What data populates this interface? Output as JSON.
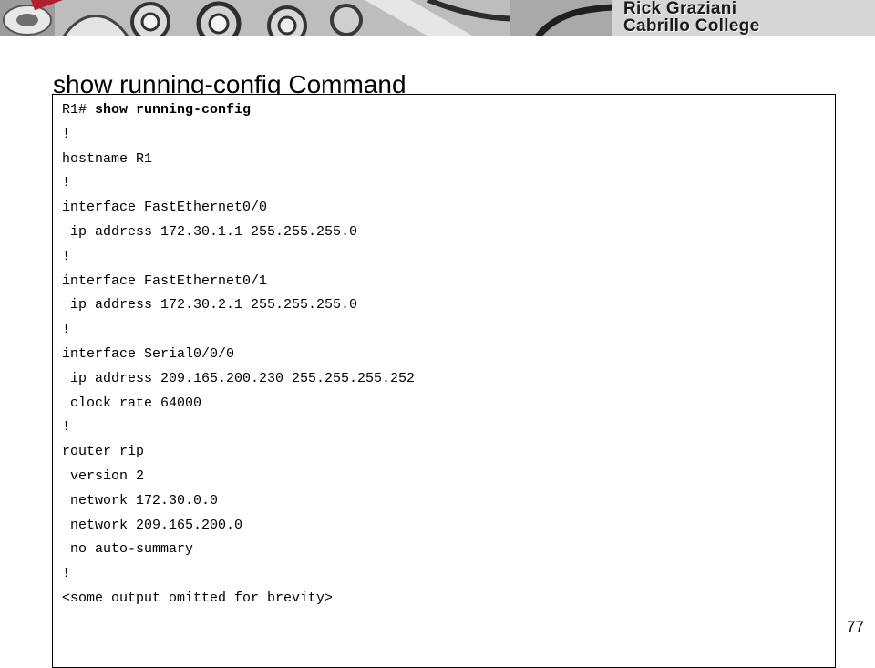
{
  "header": {
    "brand_line1": "Rick Graziani",
    "brand_line2": "Cabrillo College"
  },
  "slide": {
    "title": "show running-config Command",
    "page_number": "77"
  },
  "terminal": {
    "prompt": "R1# ",
    "command": "show running-config",
    "lines": [
      "!",
      "hostname R1",
      "!",
      "interface FastEthernet0/0",
      " ip address 172.30.1.1 255.255.255.0",
      "!",
      "interface FastEthernet0/1",
      " ip address 172.30.2.1 255.255.255.0",
      "!",
      "interface Serial0/0/0",
      " ip address 209.165.200.230 255.255.255.252",
      " clock rate 64000",
      "!",
      "router rip",
      " version 2",
      " network 172.30.0.0",
      " network 209.165.200.0",
      " no auto-summary",
      "!",
      "<some output omitted for brevity>"
    ]
  }
}
